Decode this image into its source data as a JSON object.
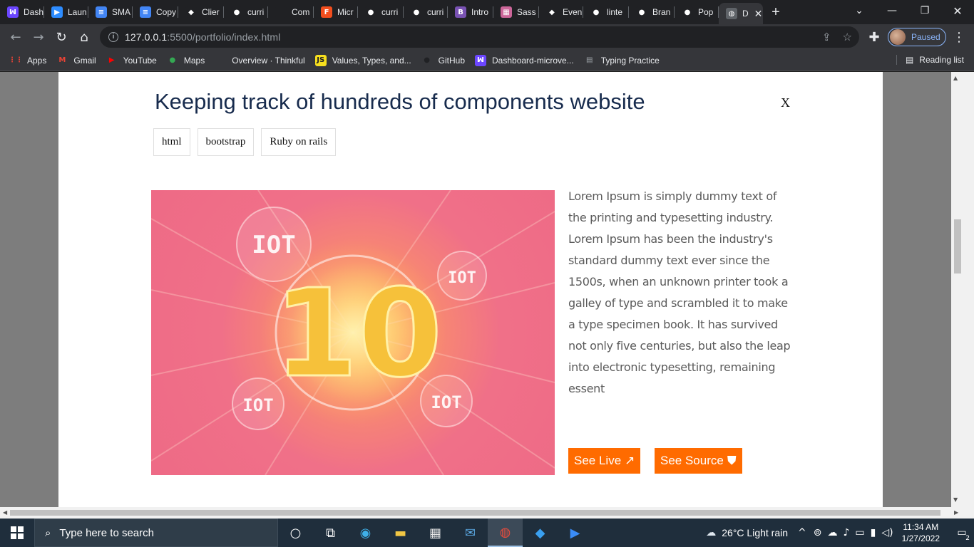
{
  "browser": {
    "tabs": [
      {
        "label": "Dash",
        "color": "#6b46ff",
        "glyph": "ꟽ"
      },
      {
        "label": "Laun",
        "color": "#2d8cff",
        "glyph": "▶"
      },
      {
        "label": "SMA",
        "color": "#4285f4",
        "glyph": "≡"
      },
      {
        "label": "Copy",
        "color": "#4285f4",
        "glyph": "≡"
      },
      {
        "label": "Clier",
        "color": "#202124",
        "glyph": "◆"
      },
      {
        "label": "curri",
        "color": "#202124",
        "glyph": "●"
      },
      {
        "label": "Com",
        "color": "#202124",
        "glyph": ""
      },
      {
        "label": "Micr",
        "color": "#f24e1e",
        "glyph": "F"
      },
      {
        "label": "curri",
        "color": "#202124",
        "glyph": "●"
      },
      {
        "label": "curri",
        "color": "#202124",
        "glyph": "●"
      },
      {
        "label": "Intro",
        "color": "#7952b3",
        "glyph": "B"
      },
      {
        "label": "Sass",
        "color": "#cc6699",
        "glyph": "▦"
      },
      {
        "label": "Even",
        "color": "#202124",
        "glyph": "◆"
      },
      {
        "label": "linte",
        "color": "#202124",
        "glyph": "●"
      },
      {
        "label": "Bran",
        "color": "#202124",
        "glyph": "●"
      },
      {
        "label": "Pop",
        "color": "#202124",
        "glyph": "●"
      },
      {
        "label": "D",
        "color": "#5f6368",
        "glyph": "◍"
      }
    ],
    "url_host": "127.0.0.1",
    "url_rest": ":5500/portfolio/index.html",
    "profile_label": "Paused",
    "bookmarks": [
      {
        "label": "Apps",
        "icon": "apps-icon",
        "color": "#ea4335",
        "glyph": "⋮⋮"
      },
      {
        "label": "Gmail",
        "icon": "gmail-icon",
        "color": "#ea4335",
        "glyph": "M"
      },
      {
        "label": "YouTube",
        "icon": "youtube-icon",
        "color": "#ff0000",
        "glyph": "▶"
      },
      {
        "label": "Maps",
        "icon": "maps-icon",
        "color": "#34a853",
        "glyph": "●"
      },
      {
        "label": "Overview · Thinkful",
        "icon": "thinkful-icon",
        "color": "#202124",
        "glyph": ""
      },
      {
        "label": "Values, Types, and...",
        "icon": "js-icon",
        "color": "#f7df1e",
        "glyph": "JS"
      },
      {
        "label": "GitHub",
        "icon": "github-icon",
        "color": "#202124",
        "glyph": "●"
      },
      {
        "label": "Dashboard-microve...",
        "icon": "microverse-icon",
        "color": "#6b46ff",
        "glyph": "ꟽ"
      },
      {
        "label": "Typing Practice",
        "icon": "typing-icon",
        "color": "#9aa0a6",
        "glyph": "▤"
      }
    ],
    "reading_list": "Reading list"
  },
  "modal": {
    "title": "Keeping track of hundreds of components website",
    "close": "X",
    "tags": [
      "html",
      "bootstrap",
      "Ruby on rails"
    ],
    "description": "Lorem Ipsum is simply dummy text of the printing and typesetting industry. Lorem Ipsum has been the industry's standard dummy text ever since the 1500s, when an unknown printer took a galley of type and scrambled it to make a type specimen book. It has survived not only five centuries, but also the leap into electronic typesetting, remaining essent",
    "see_live": "See Live",
    "see_source": "See Source",
    "image": {
      "center_text": "10",
      "badge_text": "IOT"
    }
  },
  "taskbar": {
    "search_placeholder": "Type here to search",
    "weather": "26°C  Light rain",
    "time": "11:34 AM",
    "date": "1/27/2022",
    "notifications": "2"
  }
}
